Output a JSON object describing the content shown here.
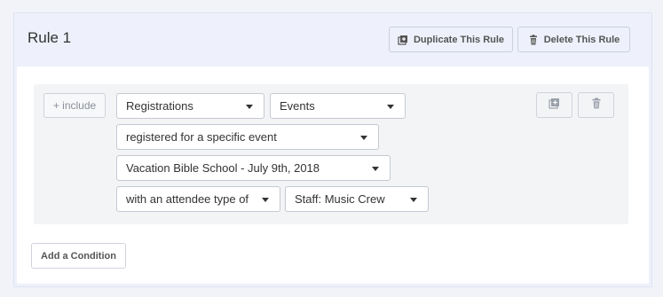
{
  "rule": {
    "title": "Rule 1",
    "duplicate_label": "Duplicate This Rule",
    "delete_label": "Delete This Rule",
    "duplicate_icon": "duplicate-icon",
    "delete_icon": "trash-icon"
  },
  "condition": {
    "include_label": "+ include",
    "category": "Registrations",
    "subcategory": "Events",
    "criteria": "registered for a specific event",
    "event": "Vacation Bible School - July 9th, 2018",
    "attendee_qualifier": "with an attendee type of",
    "attendee_type": "Staff: Music Crew",
    "duplicate_icon": "duplicate-icon",
    "delete_icon": "trash-icon"
  },
  "add_condition_label": "Add a Condition"
}
